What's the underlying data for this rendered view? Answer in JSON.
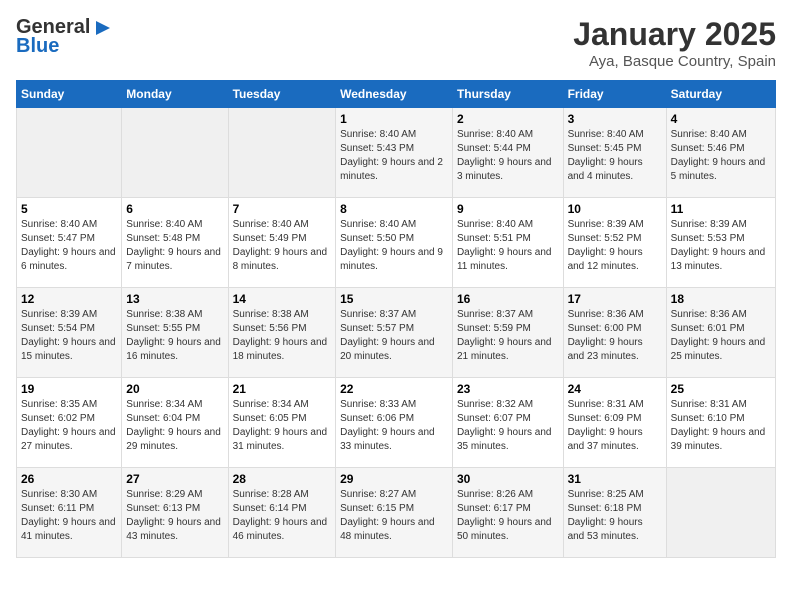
{
  "header": {
    "logo_line1": "General",
    "logo_line2": "Blue",
    "main_title": "January 2025",
    "subtitle": "Aya, Basque Country, Spain"
  },
  "weekdays": [
    "Sunday",
    "Monday",
    "Tuesday",
    "Wednesday",
    "Thursday",
    "Friday",
    "Saturday"
  ],
  "weeks": [
    [
      {
        "day": "",
        "sunrise": "",
        "sunset": "",
        "daylight": ""
      },
      {
        "day": "",
        "sunrise": "",
        "sunset": "",
        "daylight": ""
      },
      {
        "day": "",
        "sunrise": "",
        "sunset": "",
        "daylight": ""
      },
      {
        "day": "1",
        "sunrise": "8:40 AM",
        "sunset": "5:43 PM",
        "daylight": "9 hours and 2 minutes."
      },
      {
        "day": "2",
        "sunrise": "8:40 AM",
        "sunset": "5:44 PM",
        "daylight": "9 hours and 3 minutes."
      },
      {
        "day": "3",
        "sunrise": "8:40 AM",
        "sunset": "5:45 PM",
        "daylight": "9 hours and 4 minutes."
      },
      {
        "day": "4",
        "sunrise": "8:40 AM",
        "sunset": "5:46 PM",
        "daylight": "9 hours and 5 minutes."
      }
    ],
    [
      {
        "day": "5",
        "sunrise": "8:40 AM",
        "sunset": "5:47 PM",
        "daylight": "9 hours and 6 minutes."
      },
      {
        "day": "6",
        "sunrise": "8:40 AM",
        "sunset": "5:48 PM",
        "daylight": "9 hours and 7 minutes."
      },
      {
        "day": "7",
        "sunrise": "8:40 AM",
        "sunset": "5:49 PM",
        "daylight": "9 hours and 8 minutes."
      },
      {
        "day": "8",
        "sunrise": "8:40 AM",
        "sunset": "5:50 PM",
        "daylight": "9 hours and 9 minutes."
      },
      {
        "day": "9",
        "sunrise": "8:40 AM",
        "sunset": "5:51 PM",
        "daylight": "9 hours and 11 minutes."
      },
      {
        "day": "10",
        "sunrise": "8:39 AM",
        "sunset": "5:52 PM",
        "daylight": "9 hours and 12 minutes."
      },
      {
        "day": "11",
        "sunrise": "8:39 AM",
        "sunset": "5:53 PM",
        "daylight": "9 hours and 13 minutes."
      }
    ],
    [
      {
        "day": "12",
        "sunrise": "8:39 AM",
        "sunset": "5:54 PM",
        "daylight": "9 hours and 15 minutes."
      },
      {
        "day": "13",
        "sunrise": "8:38 AM",
        "sunset": "5:55 PM",
        "daylight": "9 hours and 16 minutes."
      },
      {
        "day": "14",
        "sunrise": "8:38 AM",
        "sunset": "5:56 PM",
        "daylight": "9 hours and 18 minutes."
      },
      {
        "day": "15",
        "sunrise": "8:37 AM",
        "sunset": "5:57 PM",
        "daylight": "9 hours and 20 minutes."
      },
      {
        "day": "16",
        "sunrise": "8:37 AM",
        "sunset": "5:59 PM",
        "daylight": "9 hours and 21 minutes."
      },
      {
        "day": "17",
        "sunrise": "8:36 AM",
        "sunset": "6:00 PM",
        "daylight": "9 hours and 23 minutes."
      },
      {
        "day": "18",
        "sunrise": "8:36 AM",
        "sunset": "6:01 PM",
        "daylight": "9 hours and 25 minutes."
      }
    ],
    [
      {
        "day": "19",
        "sunrise": "8:35 AM",
        "sunset": "6:02 PM",
        "daylight": "9 hours and 27 minutes."
      },
      {
        "day": "20",
        "sunrise": "8:34 AM",
        "sunset": "6:04 PM",
        "daylight": "9 hours and 29 minutes."
      },
      {
        "day": "21",
        "sunrise": "8:34 AM",
        "sunset": "6:05 PM",
        "daylight": "9 hours and 31 minutes."
      },
      {
        "day": "22",
        "sunrise": "8:33 AM",
        "sunset": "6:06 PM",
        "daylight": "9 hours and 33 minutes."
      },
      {
        "day": "23",
        "sunrise": "8:32 AM",
        "sunset": "6:07 PM",
        "daylight": "9 hours and 35 minutes."
      },
      {
        "day": "24",
        "sunrise": "8:31 AM",
        "sunset": "6:09 PM",
        "daylight": "9 hours and 37 minutes."
      },
      {
        "day": "25",
        "sunrise": "8:31 AM",
        "sunset": "6:10 PM",
        "daylight": "9 hours and 39 minutes."
      }
    ],
    [
      {
        "day": "26",
        "sunrise": "8:30 AM",
        "sunset": "6:11 PM",
        "daylight": "9 hours and 41 minutes."
      },
      {
        "day": "27",
        "sunrise": "8:29 AM",
        "sunset": "6:13 PM",
        "daylight": "9 hours and 43 minutes."
      },
      {
        "day": "28",
        "sunrise": "8:28 AM",
        "sunset": "6:14 PM",
        "daylight": "9 hours and 46 minutes."
      },
      {
        "day": "29",
        "sunrise": "8:27 AM",
        "sunset": "6:15 PM",
        "daylight": "9 hours and 48 minutes."
      },
      {
        "day": "30",
        "sunrise": "8:26 AM",
        "sunset": "6:17 PM",
        "daylight": "9 hours and 50 minutes."
      },
      {
        "day": "31",
        "sunrise": "8:25 AM",
        "sunset": "6:18 PM",
        "daylight": "9 hours and 53 minutes."
      },
      {
        "day": "",
        "sunrise": "",
        "sunset": "",
        "daylight": ""
      }
    ]
  ]
}
